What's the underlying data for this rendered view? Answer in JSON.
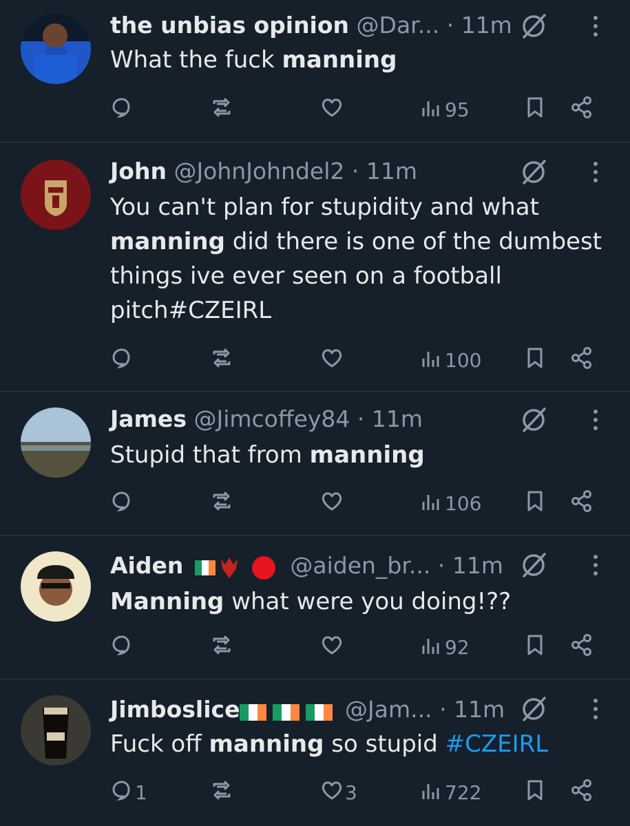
{
  "tweets": [
    {
      "name": "the unbias opinion",
      "handle": "@Dar...",
      "dot": "·",
      "time": "11m",
      "body_parts": [
        {
          "t": "What the fuck ",
          "b": false
        },
        {
          "t": "manning",
          "b": true
        }
      ],
      "replies": "",
      "retweets": "",
      "likes": "",
      "views": "95",
      "flags": []
    },
    {
      "name": "John",
      "handle": "@JohnJohndel2",
      "dot": "·",
      "time": "11m",
      "body_parts": [
        {
          "t": "You can't plan for stupidity and what ",
          "b": false
        },
        {
          "t": "manning",
          "b": true
        },
        {
          "t": " did there is one of the dumbest things ive ever seen on a football pitch#CZEIRL",
          "b": false
        }
      ],
      "replies": "",
      "retweets": "",
      "likes": "",
      "views": "100",
      "flags": []
    },
    {
      "name": "James",
      "handle": "@Jimcoffey84",
      "dot": "·",
      "time": "11m",
      "body_parts": [
        {
          "t": "Stupid that from ",
          "b": false
        },
        {
          "t": "manning",
          "b": true
        }
      ],
      "replies": "",
      "retweets": "",
      "likes": "",
      "views": "106",
      "flags": []
    },
    {
      "name": "Aiden",
      "handle": "@aiden_br...",
      "dot": "·",
      "time": "11m",
      "body_parts": [
        {
          "t": "Manning",
          "b": true
        },
        {
          "t": " what were you doing!??",
          "b": false
        }
      ],
      "replies": "",
      "retweets": "",
      "likes": "",
      "views": "92",
      "flags": [
        "ireland-flag-emoji",
        "phoenix-emoji",
        "red-circle-emoji"
      ]
    },
    {
      "name": "Jimboslice",
      "handle": "@Jam...",
      "dot": "·",
      "time": "11m",
      "body_parts": [
        {
          "t": "Fuck off ",
          "b": false
        },
        {
          "t": "manning",
          "b": true
        },
        {
          "t": " so stupid ",
          "b": false
        },
        {
          "t": "#CZEIRL",
          "b": false,
          "link": true
        }
      ],
      "replies": "1",
      "retweets": "",
      "likes": "3",
      "views": "722",
      "flags": [
        "ireland-flag-emoji",
        "ireland-flag-emoji",
        "ireland-flag-emoji"
      ]
    }
  ],
  "colors": {
    "background": "#15202b",
    "text": "#e7e9ea",
    "muted": "#8b98a5",
    "link": "#1d9bf0",
    "divider": "#2f3a45"
  },
  "icons": [
    "reply-icon",
    "retweet-icon",
    "like-icon",
    "views-icon",
    "bookmark-icon",
    "share-icon",
    "grok-icon",
    "more-icon"
  ]
}
